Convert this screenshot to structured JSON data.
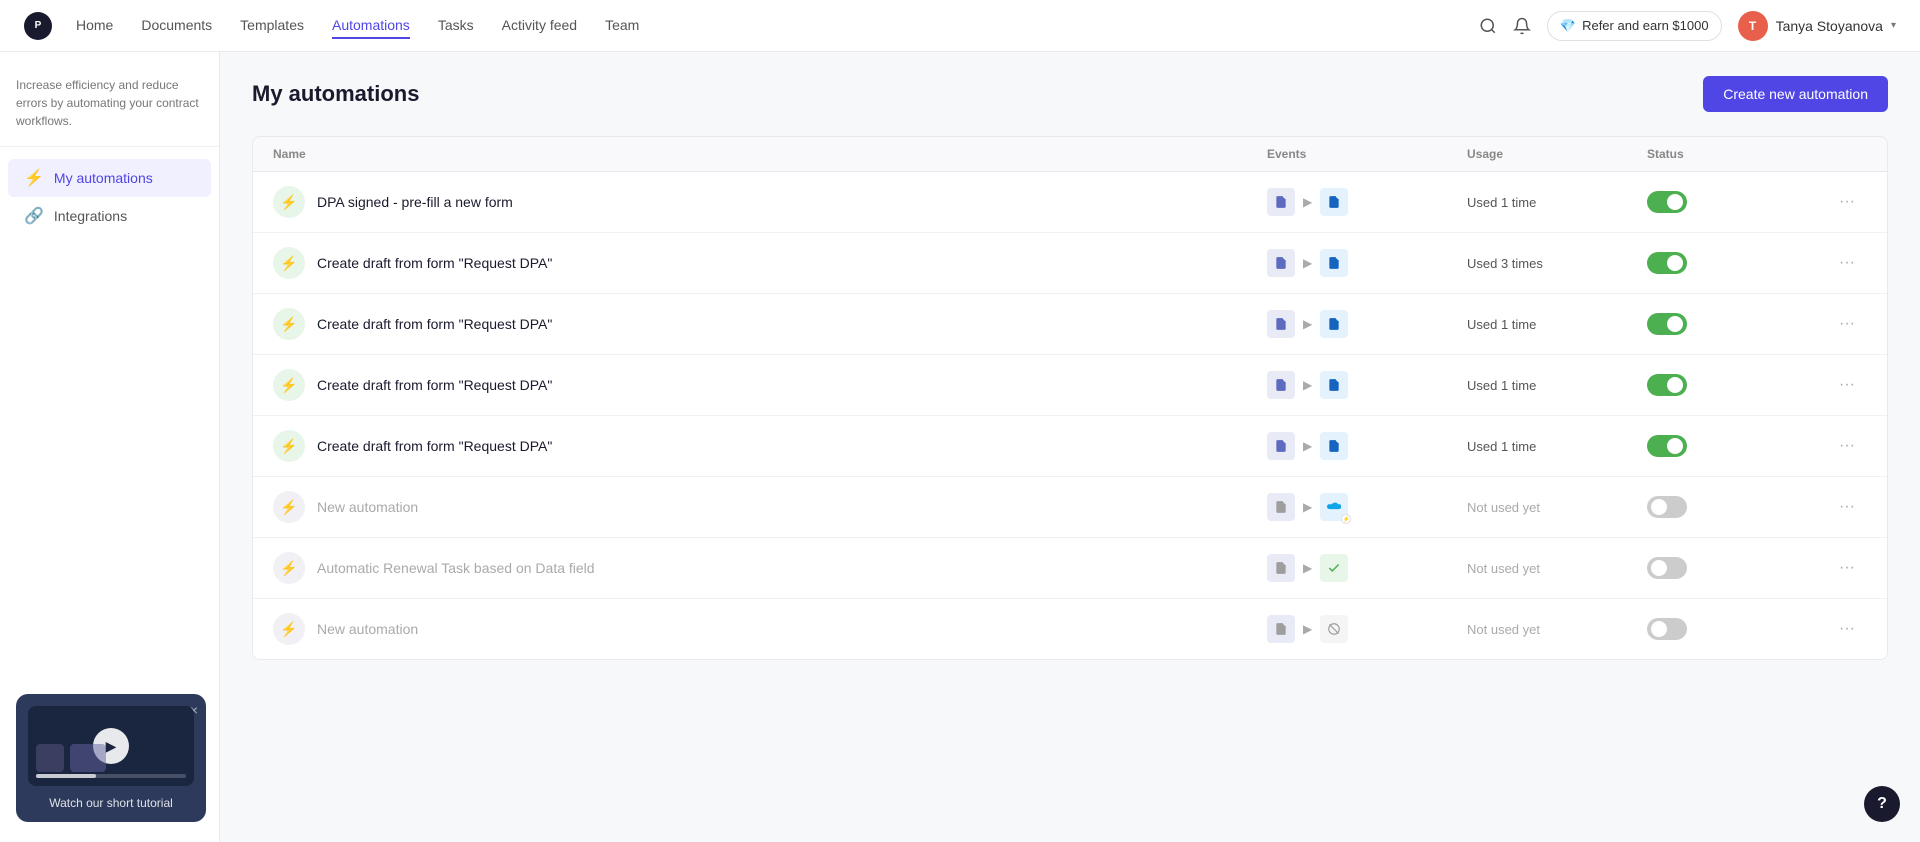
{
  "app": {
    "logo_text": "P"
  },
  "topnav": {
    "links": [
      {
        "label": "Home",
        "active": false
      },
      {
        "label": "Documents",
        "active": false
      },
      {
        "label": "Templates",
        "active": false
      },
      {
        "label": "Automations",
        "active": true
      },
      {
        "label": "Tasks",
        "active": false
      },
      {
        "label": "Activity feed",
        "active": false
      },
      {
        "label": "Team",
        "active": false
      }
    ],
    "refer_label": "Refer and earn $1000",
    "user_name": "Tanya Stoyanova",
    "user_initials": "T"
  },
  "sidebar": {
    "info_text": "Increase efficiency and reduce errors by automating your contract workflows.",
    "items": [
      {
        "label": "My automations",
        "active": true,
        "icon": "⚡"
      },
      {
        "label": "Integrations",
        "active": false,
        "icon": "🔗"
      }
    ]
  },
  "main": {
    "page_title": "My automations",
    "create_btn_label": "Create new automation",
    "table": {
      "headers": [
        "Name",
        "Events",
        "Usage",
        "Status",
        ""
      ],
      "rows": [
        {
          "id": 1,
          "name": "DPA signed - pre-fill a new form",
          "usage": "Used 1 time",
          "active": true,
          "icon_active": true
        },
        {
          "id": 2,
          "name": "Create draft from form \"Request DPA\"",
          "usage": "Used 3 times",
          "active": true,
          "icon_active": true
        },
        {
          "id": 3,
          "name": "Create draft from form \"Request DPA\"",
          "usage": "Used 1 time",
          "active": true,
          "icon_active": true
        },
        {
          "id": 4,
          "name": "Create draft from form \"Request DPA\"",
          "usage": "Used 1 time",
          "active": true,
          "icon_active": true
        },
        {
          "id": 5,
          "name": "Create draft from form \"Request DPA\"",
          "usage": "Used 1 time",
          "active": true,
          "icon_active": true
        },
        {
          "id": 6,
          "name": "New automation",
          "usage": "Not used yet",
          "active": false,
          "icon_active": false,
          "event_type": "salesforce"
        },
        {
          "id": 7,
          "name": "Automatic Renewal Task based on Data field",
          "usage": "Not used yet",
          "active": false,
          "icon_active": false,
          "event_type": "task"
        },
        {
          "id": 8,
          "name": "New automation",
          "usage": "Not used yet",
          "active": false,
          "icon_active": false,
          "event_type": "block"
        }
      ]
    }
  },
  "tutorial": {
    "label": "Watch our short tutorial",
    "close_label": "×"
  },
  "help": {
    "label": "?"
  }
}
